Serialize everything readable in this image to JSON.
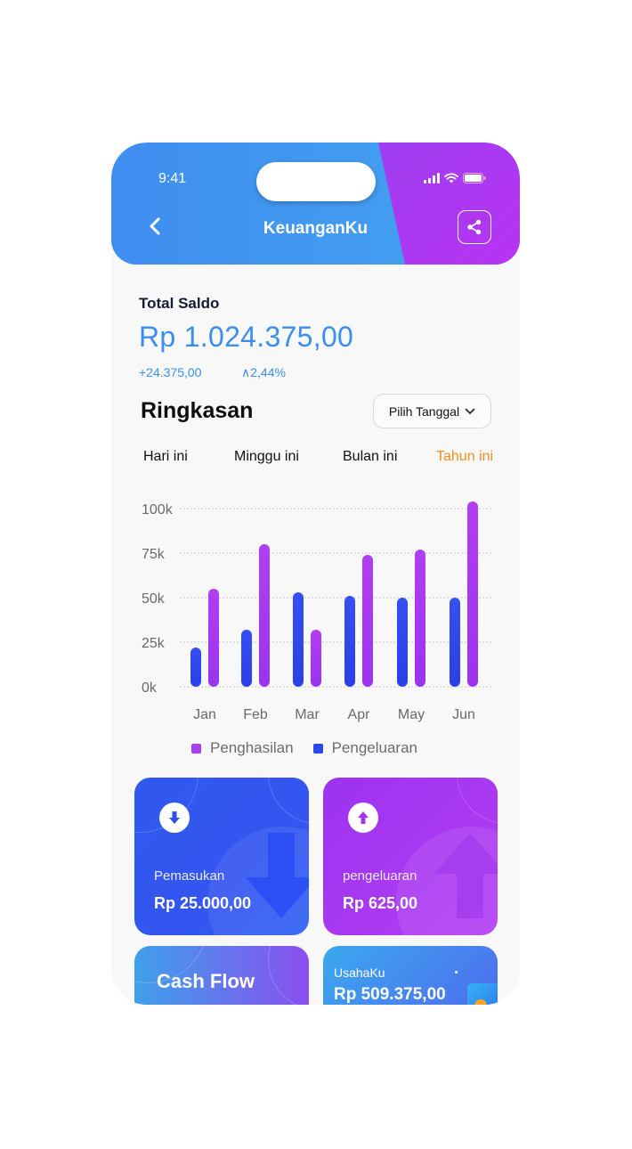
{
  "status_bar": {
    "time": "9:41"
  },
  "header": {
    "title": "KeuanganKu"
  },
  "saldo": {
    "label": "Total Saldo",
    "amount": "Rp 1.024.375,00",
    "change": "+24.375,00",
    "percent": "∧2,44%"
  },
  "summary": {
    "title": "Ringkasan",
    "date_button": "Pilih Tanggal",
    "tabs": [
      "Hari ini",
      "Minggu ini",
      "Bulan ini",
      "Tahun ini"
    ],
    "active_tab": 3
  },
  "colors": {
    "income": "#a93ef0",
    "expense": "#2c48ef",
    "accent": "#3a8ef0",
    "active_tab": "#f58d1e"
  },
  "chart_data": {
    "type": "bar",
    "categories": [
      "Jan",
      "Feb",
      "Mar",
      "Apr",
      "May",
      "Jun"
    ],
    "y_ticks": [
      "0k",
      "25k",
      "50k",
      "75k",
      "100k"
    ],
    "ylim": [
      0,
      100000
    ],
    "grid": true,
    "legend_position": "bottom",
    "series": [
      {
        "name": "Penghasilan",
        "values": [
          55000,
          80000,
          32000,
          74000,
          77000,
          104000
        ]
      },
      {
        "name": "Pengeluaran",
        "values": [
          22000,
          32000,
          53000,
          51000,
          50000,
          50000
        ]
      }
    ]
  },
  "cards": {
    "income": {
      "label": "Pemasukan",
      "amount": "Rp 25.000,00",
      "icon": "arrow-down-icon"
    },
    "expense": {
      "label": "pengeluaran",
      "amount": "Rp 625,00",
      "icon": "arrow-up-icon"
    },
    "cashflow": {
      "title": "Cash Flow"
    },
    "usaha": {
      "label": "UsahaKu",
      "amount": "Rp 509.375,00"
    }
  }
}
